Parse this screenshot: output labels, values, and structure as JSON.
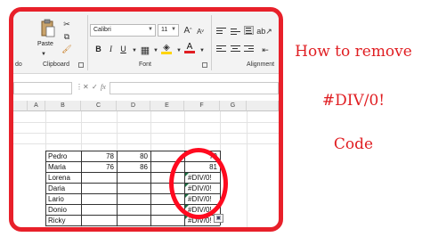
{
  "ribbon": {
    "clipboard_label": "Clipboard",
    "paste_label": "Paste",
    "font_label": "Font",
    "alignment_label": "Alignment",
    "left_partial_label": "do",
    "font_name": "Calibri",
    "font_size": "11",
    "bold": "B",
    "italic": "I",
    "underline": "U"
  },
  "formula_bar": {
    "fx": "fx",
    "cancel": "✕",
    "enter": "✓",
    "value": ""
  },
  "columns": [
    "A",
    "B",
    "C",
    "D",
    "E",
    "F",
    "G"
  ],
  "rows": [
    {
      "name": "Pedro",
      "c": "78",
      "d": "80",
      "f": "79"
    },
    {
      "name": "Maria",
      "c": "76",
      "d": "86",
      "f": "81"
    },
    {
      "name": "Lorena",
      "c": "",
      "d": "",
      "f": "#DIV/0!"
    },
    {
      "name": "Daria",
      "c": "",
      "d": "",
      "f": "#DIV/0!"
    },
    {
      "name": "Lario",
      "c": "",
      "d": "",
      "f": "#DIV/0!"
    },
    {
      "name": "Donio",
      "c": "",
      "d": "",
      "f": "#DIV/0!"
    },
    {
      "name": "Ricky",
      "c": "",
      "d": "",
      "f": "#DIV/0!"
    }
  ],
  "side_text": {
    "line1": "How to remove",
    "line2": "#DIV/0!",
    "line3": "Code"
  },
  "colors": {
    "frame": "#e8202a",
    "ellipse": "#ff0a1f",
    "text": "#e01e22",
    "error_indicator": "#1e7145"
  }
}
